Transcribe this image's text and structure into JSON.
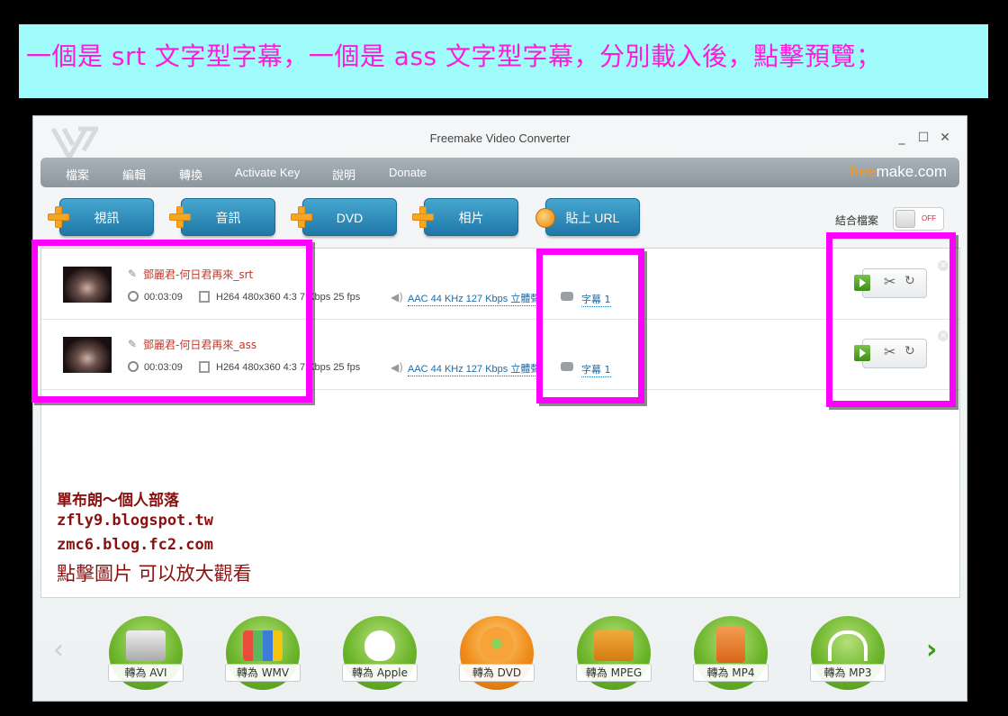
{
  "banner": {
    "text": "一個是 srt 文字型字幕，一個是 ass 文字型字幕，分別載入後，點擊預覽；"
  },
  "window": {
    "title": "Freemake Video Converter",
    "min": "_",
    "max": "☐",
    "close": "✕"
  },
  "menu": {
    "items": [
      "檔案",
      "編輯",
      "轉換",
      "Activate Key",
      "說明",
      "Donate"
    ],
    "brand_free": "free",
    "brand_make": "make.com"
  },
  "add_buttons": [
    "視訊",
    "音訊",
    "DVD",
    "相片",
    "貼上 URL"
  ],
  "combine": {
    "label": "結合檔案",
    "toggle": "OFF"
  },
  "files": [
    {
      "name": "鄧麗君-何日君再來_srt",
      "duration": "00:03:09",
      "video": "H264  480x360  4:3   7 Kbps  25 fps",
      "audio": "AAC  44 KHz  127 Kbps  立體聲",
      "subtitle": "字幕 1"
    },
    {
      "name": "鄧麗君-何日君再來_ass",
      "duration": "00:03:09",
      "video": "H264  480x360  4:3   7 Kbps  25 fps",
      "audio": "AAC  44 KHz  127 Kbps  立體聲",
      "subtitle": "字幕 1"
    }
  ],
  "watermark": {
    "line1": "單布朗～個人部落",
    "line2": "zfly9.blogspot.tw",
    "line3": "zmc6.blog.fc2.com",
    "line4": "點擊圖片 可以放大觀看"
  },
  "convert": [
    "轉為 AVI",
    "轉為 WMV",
    "轉為 Apple",
    "轉為 DVD",
    "轉為 MPEG",
    "轉為 MP4",
    "轉為 MP3"
  ],
  "colors": {
    "highlight": "#ff00ff",
    "banner_bg": "#9ffcfb",
    "banner_text": "#ff1ad9",
    "accent_blue": "#1f77a6",
    "brand_orange": "#f39a1e",
    "file_name": "#c0392b"
  }
}
